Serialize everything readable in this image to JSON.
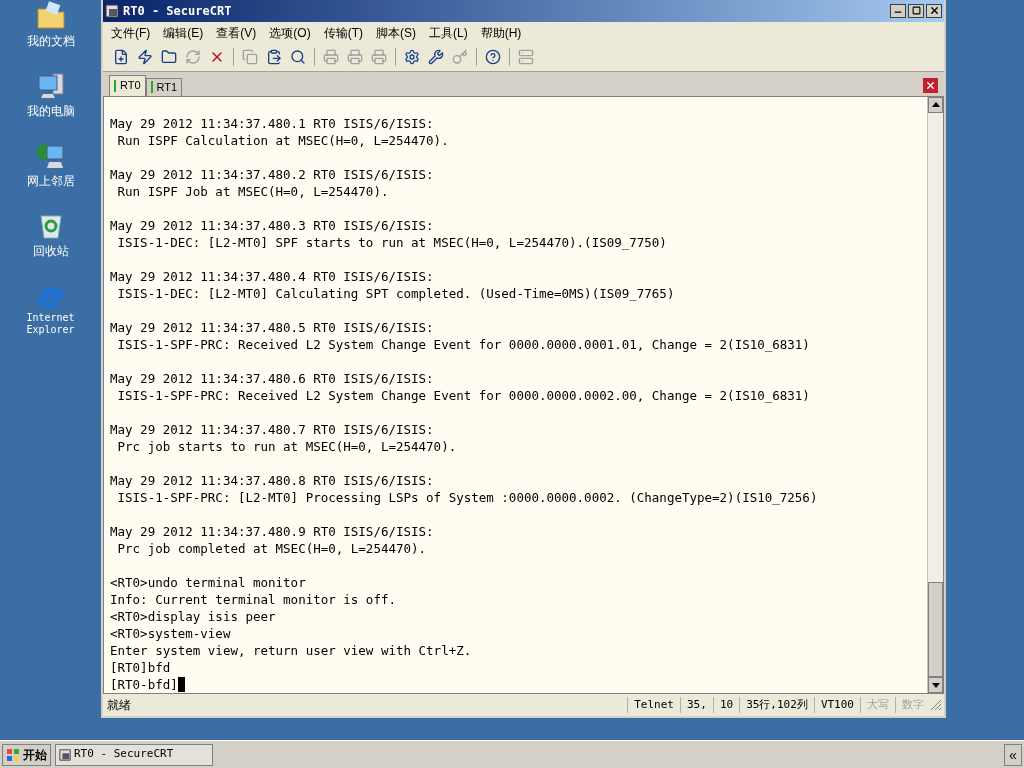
{
  "desktop_icons": [
    {
      "kind": "folder",
      "label": "我的文档"
    },
    {
      "kind": "computer",
      "label": "我的电脑"
    },
    {
      "kind": "network",
      "label": "网上邻居"
    },
    {
      "kind": "recycle",
      "label": "回收站"
    },
    {
      "kind": "browser",
      "label": "Internet Explorer"
    }
  ],
  "window": {
    "title": "RT0 - SecureCRT"
  },
  "menu": [
    "文件(F)",
    "编辑(E)",
    "查看(V)",
    "选项(O)",
    "传输(T)",
    "脚本(S)",
    "工具(L)",
    "帮助(H)"
  ],
  "toolbar": [
    {
      "kind": "connect",
      "disabled": false
    },
    {
      "kind": "quick",
      "disabled": false
    },
    {
      "kind": "tab",
      "disabled": false
    },
    {
      "kind": "reconnect",
      "disabled": true
    },
    {
      "kind": "disconnect",
      "disabled": false
    },
    {
      "kind": "sep"
    },
    {
      "kind": "copy",
      "disabled": true
    },
    {
      "kind": "paste",
      "disabled": false
    },
    {
      "kind": "find",
      "disabled": false
    },
    {
      "kind": "sep"
    },
    {
      "kind": "print",
      "disabled": true
    },
    {
      "kind": "print",
      "disabled": true
    },
    {
      "kind": "printer",
      "disabled": true
    },
    {
      "kind": "sep"
    },
    {
      "kind": "options",
      "disabled": false
    },
    {
      "kind": "map",
      "disabled": false
    },
    {
      "kind": "key",
      "disabled": true
    },
    {
      "kind": "sep"
    },
    {
      "kind": "help",
      "disabled": false
    },
    {
      "kind": "sep"
    },
    {
      "kind": "sftp",
      "disabled": true
    }
  ],
  "tabs": [
    {
      "label": "RT0",
      "selected": true
    },
    {
      "label": "RT1",
      "selected": false
    }
  ],
  "log_entries": [
    {
      "header": "May 29 2012 11:34:37.480.1 RT0 ISIS/6/ISIS:",
      "message": " Run ISPF Calculation at MSEC(H=0, L=254470)."
    },
    {
      "header": "May 29 2012 11:34:37.480.2 RT0 ISIS/6/ISIS:",
      "message": " Run ISPF Job at MSEC(H=0, L=254470)."
    },
    {
      "header": "May 29 2012 11:34:37.480.3 RT0 ISIS/6/ISIS:",
      "message": " ISIS-1-DEC: [L2-MT0] SPF starts to run at MSEC(H=0, L=254470).(IS09_7750)"
    },
    {
      "header": "May 29 2012 11:34:37.480.4 RT0 ISIS/6/ISIS:",
      "message": " ISIS-1-DEC: [L2-MT0] Calculating SPT completed. (Used-Time=0MS)(IS09_7765)"
    },
    {
      "header": "May 29 2012 11:34:37.480.5 RT0 ISIS/6/ISIS:",
      "message": " ISIS-1-SPF-PRC: Received L2 System Change Event for 0000.0000.0001.01, Change = 2(IS10_6831)"
    },
    {
      "header": "May 29 2012 11:34:37.480.6 RT0 ISIS/6/ISIS:",
      "message": " ISIS-1-SPF-PRC: Received L2 System Change Event for 0000.0000.0002.00, Change = 2(IS10_6831)"
    },
    {
      "header": "May 29 2012 11:34:37.480.7 RT0 ISIS/6/ISIS:",
      "message": " Prc job starts to run at MSEC(H=0, L=254470)."
    },
    {
      "header": "May 29 2012 11:34:37.480.8 RT0 ISIS/6/ISIS:",
      "message": " ISIS-1-SPF-PRC: [L2-MT0] Processing LSPs of System :0000.0000.0002. (ChangeType=2)(IS10_7256)"
    },
    {
      "header": "May 29 2012 11:34:37.480.9 RT0 ISIS/6/ISIS:",
      "message": " Prc job completed at MSEC(H=0, L=254470)."
    }
  ],
  "console_lines": [
    "<RT0>undo terminal monitor",
    "Info: Current terminal monitor is off.",
    "<RT0>display isis peer",
    "<RT0>system-view",
    "Enter system view, return user view with Ctrl+Z.",
    "[RT0]bfd",
    "[RT0-bfd]"
  ],
  "status_bar": {
    "message": "就绪",
    "fields": [
      {
        "text": "Telnet",
        "disabled": false
      },
      {
        "text": "35,",
        "disabled": false
      },
      {
        "text": "10",
        "disabled": false
      },
      {
        "text": "35行,102列",
        "disabled": false
      },
      {
        "text": "VT100",
        "disabled": false
      },
      {
        "text": "大写",
        "disabled": true
      },
      {
        "text": "数字",
        "disabled": true
      }
    ]
  },
  "taskbar": {
    "start": "开始",
    "tasks": [
      {
        "label": "RT0 - SecureCRT",
        "selected": false
      }
    ],
    "tray": "«"
  }
}
